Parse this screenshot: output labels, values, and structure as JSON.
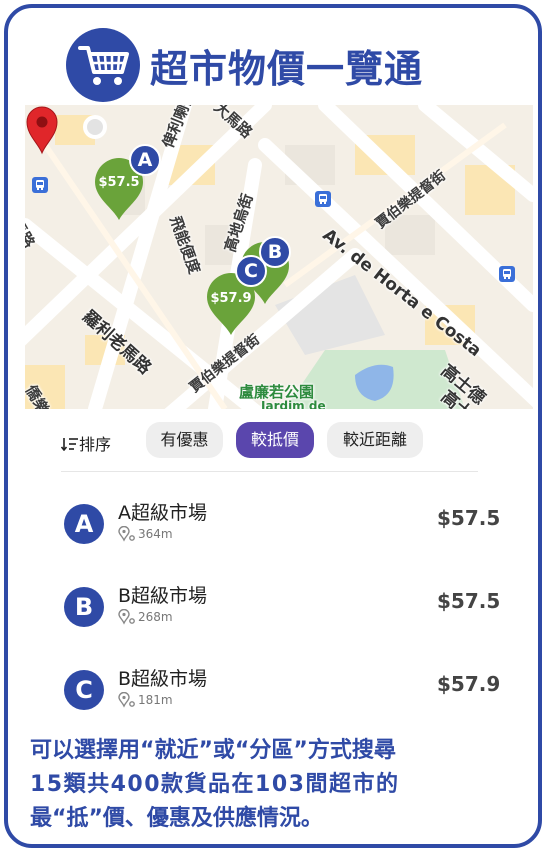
{
  "header": {
    "title": "超市物價一覽通",
    "logo_icon": "shopping-cart-icon",
    "brand_color": "#2f4aa6"
  },
  "map": {
    "streets": {
      "s1": "大馬路",
      "s2": "俾利喇街",
      "s3": "高地烏街",
      "s4": "飛能便度",
      "s5": "賈伯樂提督街",
      "s6": "Av. de Horta e Costa",
      "s7": "羅利老馬路",
      "s8": "賈伯樂提督街",
      "s9": "高士德",
      "s10": "高士德大",
      "s11": "馬路",
      "s12": "僑樂"
    },
    "park": "盧廉若公園",
    "park_sub": "Jardim de",
    "markers": [
      {
        "letter": "A",
        "price": "$57.5"
      },
      {
        "letter": "B",
        "price": ""
      },
      {
        "letter": "C",
        "price": "$57.9"
      }
    ],
    "pin_color": "#6aa33a",
    "location_pin_icon": "location-pin-icon",
    "bus_stop_icon": "bus-stop-icon"
  },
  "filters": {
    "sort_label": "排序",
    "sort_icon": "sort-icon",
    "chips": [
      {
        "label": "有優惠",
        "active": false
      },
      {
        "label": "較抵價",
        "active": true
      },
      {
        "label": "較近距離",
        "active": false
      }
    ],
    "active_color": "#5a46ad"
  },
  "stores": [
    {
      "letter": "A",
      "name": "A超級市場",
      "distance": "364m",
      "price": "$57.5"
    },
    {
      "letter": "B",
      "name": "B超級市場",
      "distance": "268m",
      "price": "$57.5"
    },
    {
      "letter": "C",
      "name": "B超級市場",
      "distance": "181m",
      "price": "$57.9"
    }
  ],
  "caption": {
    "line1": "可以選擇用“就近”或“分區”方式搜尋",
    "line2": "15類共400款貨品在103間超市的",
    "line3": "最“抵”價、優惠及供應情況。"
  }
}
